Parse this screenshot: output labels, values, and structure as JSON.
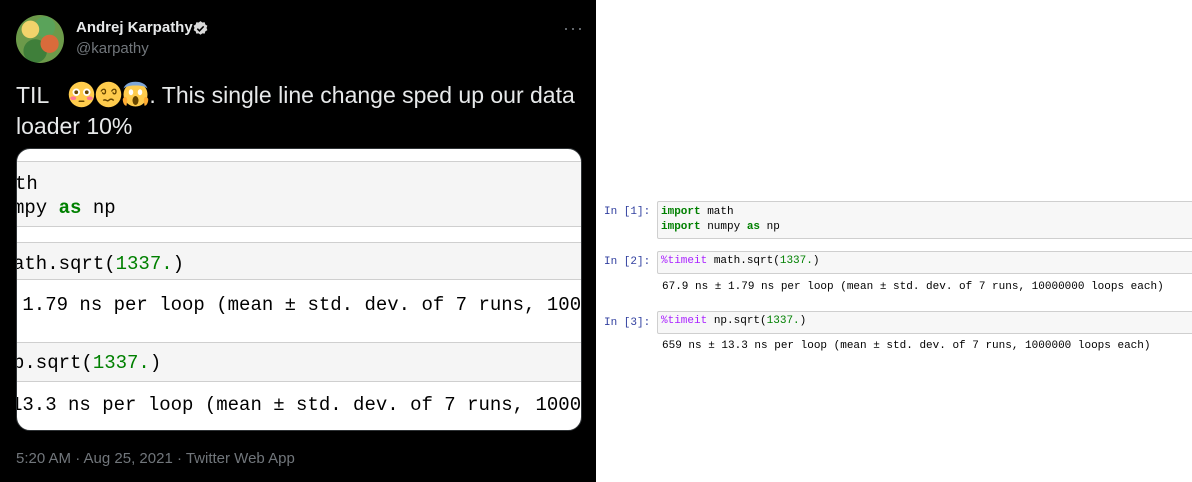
{
  "tweet": {
    "display_name": "Andrej Karpathy",
    "handle": "@karpathy",
    "more": "···",
    "text_prefix": "TIL",
    "emojis": [
      "flushed-face-emoji",
      "dizzy-face-emoji",
      "screaming-face-emoji"
    ],
    "text_line1": ". This single line change sped up our data",
    "text_line2": "loader 10%",
    "timestamp": "5:20 AM · Aug 25, 2021 · Twitter Web App",
    "media": {
      "line1": "th",
      "line2_pre": "mpy ",
      "line2_kw": "as",
      "line2_post": " np",
      "line3_pre": "ath.sqrt(",
      "line3_num": "1337.",
      "line3_post": ")",
      "out1": " 1.79 ns per loop (mean ± std. dev. of 7 runs, 1000",
      "line4_pre": "p.sqrt(",
      "line4_num": "1337.",
      "line4_post": ")",
      "out2": "13.3 ns per loop (mean ± std. dev. of 7 runs, 1000"
    }
  },
  "notebook": {
    "cells": [
      {
        "prompt": "In [1]:",
        "line1_kw": "import",
        "line1_rest": " math",
        "line2_kw": "import",
        "line2_mid": " numpy ",
        "line2_kw2": "as",
        "line2_rest": " np"
      },
      {
        "prompt": "In [2]:",
        "magic": "%timeit",
        "code_pre": " math.sqrt(",
        "num": "1337.",
        "code_post": ")",
        "output": "67.9 ns ± 1.79 ns per loop (mean ± std. dev. of 7 runs, 10000000 loops each)"
      },
      {
        "prompt": "In [3]:",
        "magic": "%timeit",
        "code_pre": " np.sqrt(",
        "num": "1337.",
        "code_post": ")",
        "output": "659 ns ± 13.3 ns per loop (mean ± std. dev. of 7 runs, 1000000 loops each)"
      }
    ]
  },
  "colors": {
    "tweet_bg": "#000000",
    "tweet_text": "#e7e9ea",
    "muted": "#71767b",
    "verified": "#d9d9d9",
    "keyword_green": "#008000",
    "prompt_blue": "#303f9f",
    "magic_purple": "#aa22ff"
  }
}
